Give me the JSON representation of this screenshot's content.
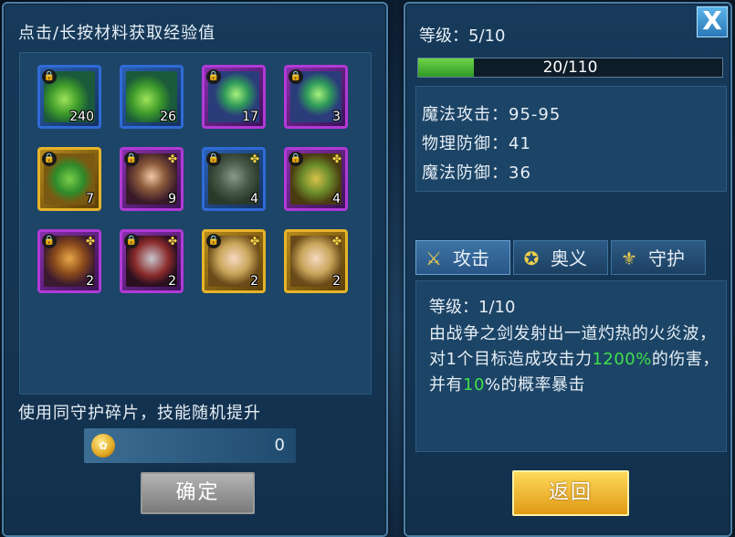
{
  "left_panel": {
    "title": "点击/长按材料获取经验值",
    "items": [
      {
        "count": "240",
        "rarity": "blue",
        "art": "leaf",
        "locked": true,
        "icon": "leaf-material-icon"
      },
      {
        "count": "26",
        "rarity": "blue",
        "art": "leaf",
        "locked": false,
        "icon": "leaf-material-icon"
      },
      {
        "count": "17",
        "rarity": "purple",
        "art": "crystal",
        "locked": true,
        "icon": "crystal-material-icon"
      },
      {
        "count": "3",
        "rarity": "purple",
        "art": "crystal",
        "locked": true,
        "icon": "crystal-material-icon"
      },
      {
        "count": "7",
        "rarity": "gold",
        "art": "leafgold",
        "locked": true,
        "icon": "leaf-material-icon"
      },
      {
        "count": "9",
        "rarity": "purple",
        "art": "hero1",
        "locked": true,
        "icon": "hero-portrait-icon"
      },
      {
        "count": "4",
        "rarity": "blue",
        "art": "hero2",
        "locked": true,
        "icon": "hero-portrait-icon"
      },
      {
        "count": "4",
        "rarity": "purple",
        "art": "hero3",
        "locked": true,
        "icon": "hero-portrait-icon"
      },
      {
        "count": "2",
        "rarity": "purple",
        "art": "hero4",
        "locked": true,
        "icon": "hero-portrait-icon"
      },
      {
        "count": "2",
        "rarity": "purple",
        "art": "hero5",
        "locked": true,
        "icon": "hero-portrait-icon"
      },
      {
        "count": "2",
        "rarity": "gold",
        "art": "hero6",
        "locked": true,
        "icon": "hero-portrait-icon"
      },
      {
        "count": "2",
        "rarity": "gold",
        "art": "hero6",
        "locked": false,
        "icon": "hero-portrait-icon"
      }
    ],
    "footer_text": "使用同守护碎片，技能随机提升",
    "coin_value": "0",
    "confirm_label": "确定"
  },
  "right_panel": {
    "close_label": "X",
    "level": "等级：5/10",
    "xp": {
      "text": "20/110",
      "current": 20,
      "max": 110
    },
    "stats": [
      "魔法攻击：95-95",
      "物理防御：41",
      "魔法防御：36"
    ],
    "tabs": [
      {
        "label": "攻击",
        "icon": "sword-icon",
        "glyph": "⚔",
        "active": true
      },
      {
        "label": "奥义",
        "icon": "emblem-icon",
        "glyph": "✪",
        "active": false
      },
      {
        "label": "守护",
        "icon": "shield-trident-icon",
        "glyph": "⚜",
        "active": false
      }
    ],
    "skill": {
      "level": "等级：1/10",
      "desc_part1": "由战争之剑发射出一道灼热的火炎波，对1个目标造成攻击力",
      "desc_hl1": "1200%",
      "desc_part2": "的伤害，并有",
      "desc_hl2": "10",
      "desc_part3": "%的概率暴击"
    },
    "back_label": "返回"
  },
  "colors": {
    "accent_green": "#3fe04a",
    "xp_fill": "#2e9a24",
    "back_button": "#e09a14"
  }
}
